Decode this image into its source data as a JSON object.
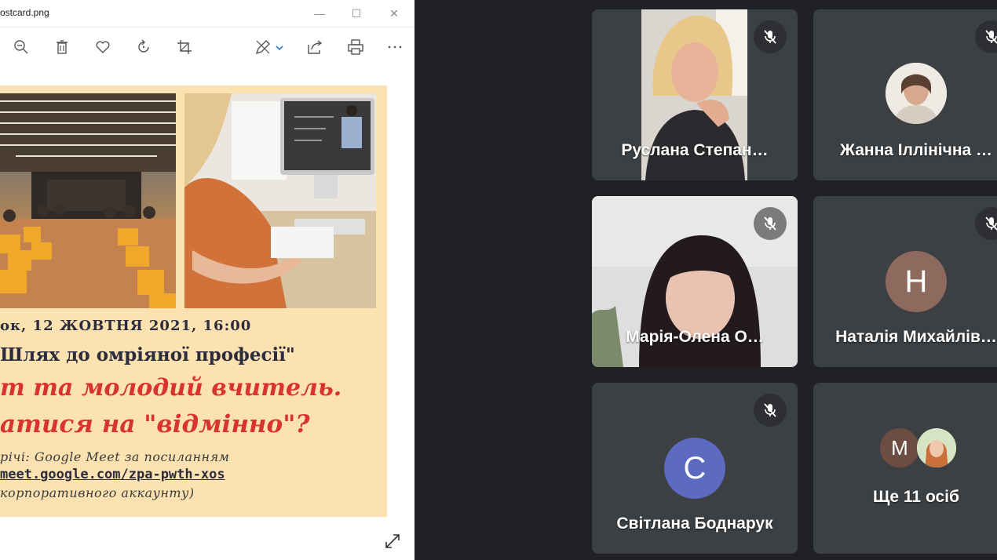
{
  "viewer": {
    "title": "ostcard.png",
    "controls": {
      "minimize": "—",
      "maximize": "☐",
      "close": "✕"
    },
    "toolbar_icons": [
      "zoom-out-icon",
      "delete-icon",
      "favorite-icon",
      "rotate-icon",
      "crop-icon",
      "edit-icon",
      "share-icon",
      "print-icon",
      "more-icon"
    ]
  },
  "postcard": {
    "date_line": "ок, 12 ЖОВТНЯ 2021, 16:00",
    "topic_line": "Шлях до омріяної професії\"",
    "headline_1": "т та молодий вчитель.",
    "headline_2": "атися на \"відмінно\"?",
    "meet_line": "річі: Google Meet за посиланням",
    "link": "meet.google.com/zpa-pwth-xos",
    "note": "корпоративного аккаунту)"
  },
  "participants": [
    {
      "name": "Руслана Степан…",
      "type": "video",
      "muted": true
    },
    {
      "name": "Жанна Іллінічна …",
      "type": "photo-avatar",
      "muted": true
    },
    {
      "name": "Марія-Олена О…",
      "type": "video",
      "muted": true
    },
    {
      "name": "Наталія Михайлів…",
      "type": "letter-avatar",
      "letter": "Н",
      "color": "#8e6a5e",
      "muted": true
    },
    {
      "name": "Світлана Боднарук",
      "type": "letter-avatar",
      "letter": "С",
      "color": "#5c6bc0",
      "muted": true
    }
  ],
  "overflow_tile": {
    "label": "Ще 11 осіб",
    "avatar_letter": "М",
    "avatar_color": "#6d4c41"
  }
}
